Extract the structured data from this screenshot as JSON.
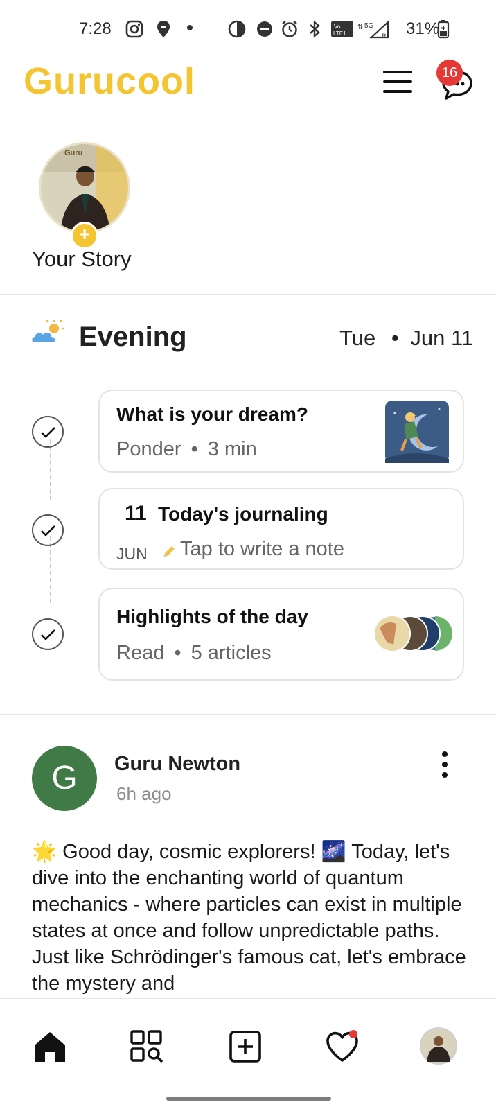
{
  "status_bar": {
    "time": "7:28",
    "battery": "31%",
    "network": "5G"
  },
  "header": {
    "brand": "Gurucool",
    "notification_count": "16",
    "brand_color": "#f4c531"
  },
  "story": {
    "label": "Your Story"
  },
  "evening": {
    "title": "Evening",
    "day": "Tue",
    "date": "Jun 11",
    "cards": [
      {
        "title": "What is your dream?",
        "type": "Ponder",
        "meta": "3 min"
      },
      {
        "day_num": "11",
        "month": "JUN",
        "title": "Today's journaling",
        "subtitle": "Tap to write a note"
      },
      {
        "title": "Highlights of the day",
        "type": "Read",
        "meta": "5 articles"
      }
    ]
  },
  "post": {
    "avatar_letter": "G",
    "author": "Guru Newton",
    "time": "6h ago",
    "body": "Good day, cosmic explorers! 🌌 Today, let's dive into the enchanting world of quantum mechanics - where particles can exist in multiple states at once and follow unpredictable paths. Just like Schrödinger's famous cat, let's embrace the mystery and",
    "body_emoji": "🌟"
  },
  "bottom_nav": {
    "items": [
      "home-icon",
      "explore-icon",
      "add-post-icon",
      "activity-heart-icon",
      "profile-avatar"
    ],
    "active": "home-icon"
  }
}
